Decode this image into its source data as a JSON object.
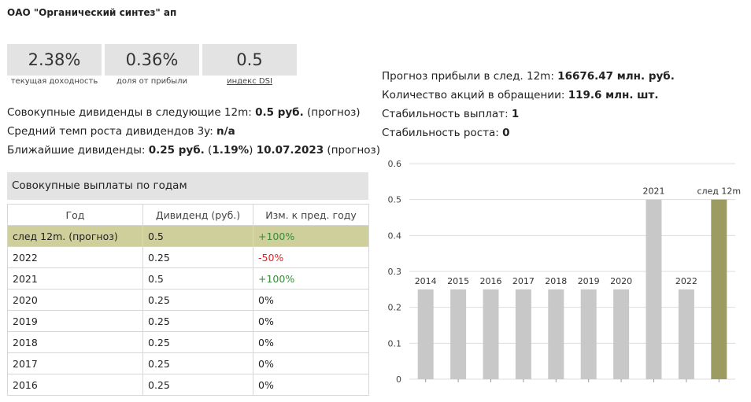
{
  "title": "ОАО \"Органический синтез\" ап",
  "stats": [
    {
      "value": "2.38%",
      "label": "текущая доходность"
    },
    {
      "value": "0.36%",
      "label": "доля от прибыли"
    },
    {
      "value": "0.5",
      "label": "индекс DSI"
    }
  ],
  "info": {
    "l1_pre": "Совокупные дивиденды в следующие 12m: ",
    "l1_val": "0.5 руб.",
    "l1_post": " (прогноз)",
    "l2_pre": "Средний темп роста дивидендов 3y: ",
    "l2_val": "n/a",
    "l3_pre": "Ближайшие дивиденды: ",
    "l3_val": "0.25 руб.",
    "l3_mid1": " (",
    "l3_pct": "1.19%",
    "l3_mid2": ") ",
    "l3_date": "10.07.2023",
    "l3_post": " (прогноз)"
  },
  "right_info": [
    {
      "label": "Прогноз прибыли в след. 12m: ",
      "value": "16676.47 млн. руб."
    },
    {
      "label": "Количество акций в обращении: ",
      "value": "119.6 млн. шт."
    },
    {
      "label": "Стабильность выплат: ",
      "value": "1"
    },
    {
      "label": "Стабильность роста: ",
      "value": "0"
    }
  ],
  "table": {
    "title": "Совокупные выплаты по годам",
    "headers": [
      "Год",
      "Дивиденд (руб.)",
      "Изм. к пред. году"
    ],
    "rows": [
      {
        "year": "след 12m. (прогноз)",
        "div": "0.5",
        "chg": "+100%",
        "dir": "pos"
      },
      {
        "year": "2022",
        "div": "0.25",
        "chg": "-50%",
        "dir": "neg"
      },
      {
        "year": "2021",
        "div": "0.5",
        "chg": "+100%",
        "dir": "pos"
      },
      {
        "year": "2020",
        "div": "0.25",
        "chg": "0%",
        "dir": ""
      },
      {
        "year": "2019",
        "div": "0.25",
        "chg": "0%",
        "dir": ""
      },
      {
        "year": "2018",
        "div": "0.25",
        "chg": "0%",
        "dir": ""
      },
      {
        "year": "2017",
        "div": "0.25",
        "chg": "0%",
        "dir": ""
      },
      {
        "year": "2016",
        "div": "0.25",
        "chg": "0%",
        "dir": ""
      }
    ]
  },
  "chart_data": {
    "type": "bar",
    "categories": [
      "2014",
      "2015",
      "2016",
      "2017",
      "2018",
      "2019",
      "2020",
      "2021",
      "2022",
      "след 12m"
    ],
    "values": [
      0.25,
      0.25,
      0.25,
      0.25,
      0.25,
      0.25,
      0.25,
      0.5,
      0.25,
      0.5
    ],
    "ylim": [
      0,
      0.6
    ],
    "yticks": [
      "0",
      "0.1",
      "0.2",
      "0.3",
      "0.4",
      "0.5",
      "0.6"
    ],
    "grid": true,
    "colors": {
      "bar": "#c8c8c8",
      "highlight": "#9c9b62",
      "grid": "#dddddd"
    }
  }
}
